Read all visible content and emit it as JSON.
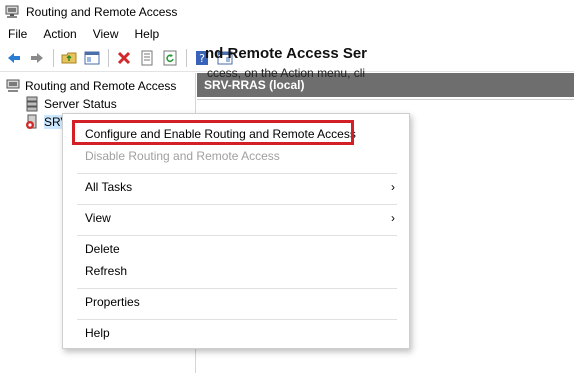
{
  "window": {
    "title": "Routing and Remote Access"
  },
  "menubar": {
    "items": [
      "File",
      "Action",
      "View",
      "Help"
    ]
  },
  "toolbar": {
    "buttons": [
      "back-icon",
      "forward-icon",
      "up-folder-icon",
      "show-hide-tree-icon",
      "delete-icon",
      "properties-icon",
      "refresh-icon",
      "help-icon",
      "console-tree-icon"
    ]
  },
  "tree": {
    "root": "Routing and Remote Access",
    "items": [
      {
        "label": "Server Status"
      },
      {
        "label": "SRV-"
      }
    ]
  },
  "panel": {
    "header": "SRV-RRAS (local)",
    "welcome_title": "nd Remote Access Ser",
    "welcome_text": "ccess, on the Action menu, cli"
  },
  "context_menu": {
    "configure": "Configure and Enable Routing and Remote Access",
    "disable": "Disable Routing and Remote Access",
    "all_tasks": "All Tasks",
    "view": "View",
    "delete": "Delete",
    "refresh": "Refresh",
    "properties": "Properties",
    "help": "Help",
    "chevron": "›"
  },
  "colors": {
    "highlight": "#d32027",
    "panel_header": "#6e6e6e",
    "selection": "#cce8ff"
  }
}
